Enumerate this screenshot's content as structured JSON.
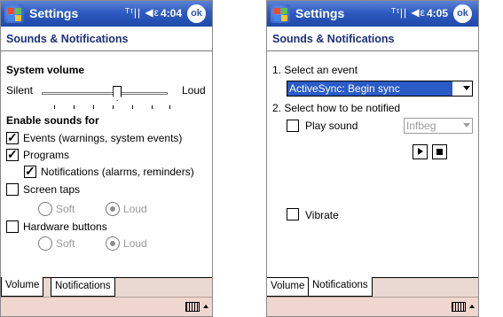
{
  "left": {
    "title": "Settings",
    "tray_icons": "ᵀᵗ|| ◀ε",
    "time": "4:04",
    "ok_label": "ok",
    "header": "Sounds & Notifications",
    "system_volume_label": "System volume",
    "silent_label": "Silent",
    "loud_label": "Loud",
    "volume_level": 0.6,
    "enable_sounds_label": "Enable sounds for",
    "checkboxes": [
      {
        "label": "Events (warnings, system events)",
        "checked": true
      },
      {
        "label": "Programs",
        "checked": true
      },
      {
        "label": "Notifications (alarms, reminders)",
        "checked": true
      },
      {
        "label": "Screen taps",
        "checked": false
      },
      {
        "label": "Hardware buttons",
        "checked": false
      }
    ],
    "screen_taps_soft": "Soft",
    "screen_taps_loud": "Loud",
    "hw_soft": "Soft",
    "hw_loud": "Loud",
    "tabs": [
      "Volume",
      "Notifications"
    ],
    "active_tab": "Volume"
  },
  "right": {
    "title": "Settings",
    "tray_icons": "ᵀᵗ|| ◀ε",
    "time": "4:05",
    "ok_label": "ok",
    "header": "Sounds & Notifications",
    "step1_label": "1. Select an event",
    "event_value": "ActiveSync: Begin sync",
    "step2_label": "2. Select how to be notified",
    "play_sound_label": "Play sound",
    "play_sound_checked": false,
    "sound_value": "Infbeg",
    "vibrate_label": "Vibrate",
    "vibrate_checked": false,
    "tabs": [
      "Volume",
      "Notifications"
    ],
    "active_tab": "Notifications"
  }
}
